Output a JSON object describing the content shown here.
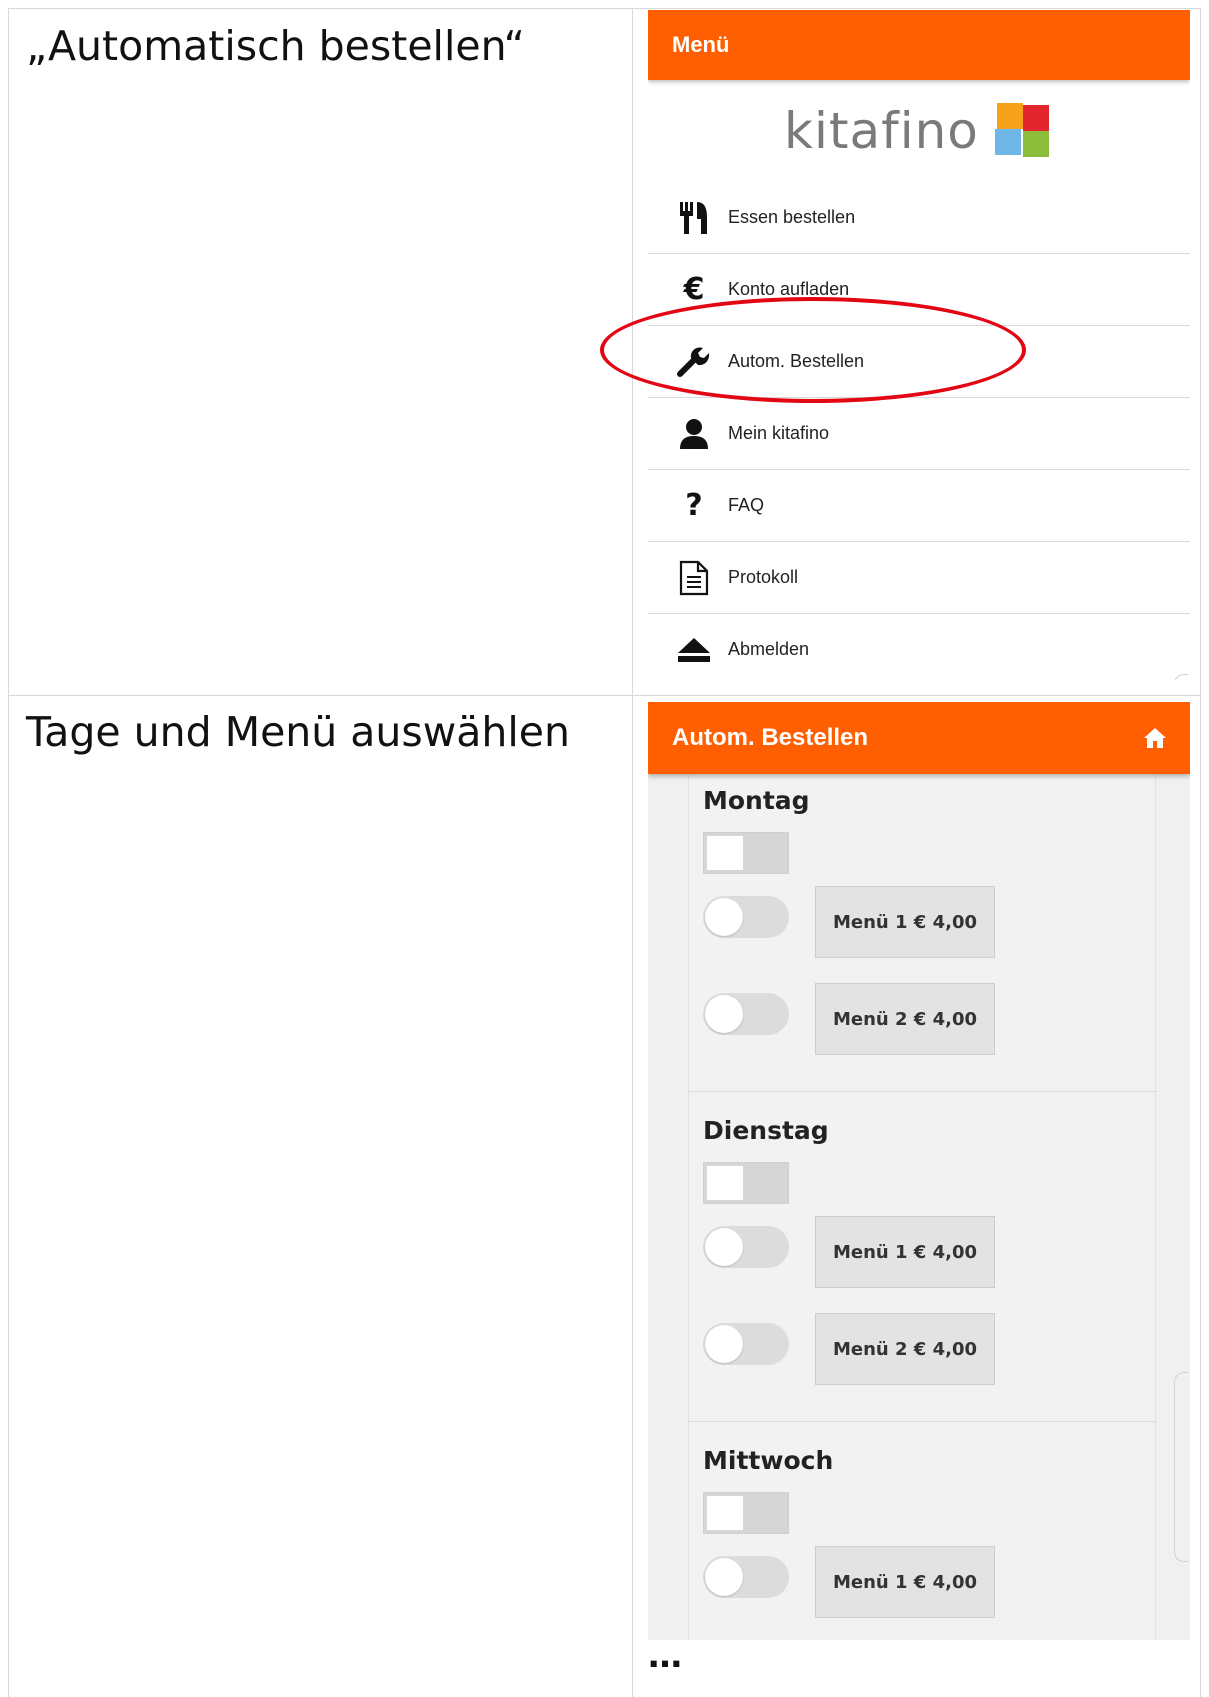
{
  "captions": {
    "first": "„Automatisch bestellen“",
    "second": "Tage und Menü auswählen"
  },
  "menu_screen": {
    "header_title": "Menü",
    "logo_text": "kitafino",
    "items": [
      {
        "label": "Essen bestellen",
        "icon": "cutlery-icon"
      },
      {
        "label": "Konto aufladen",
        "icon": "euro-icon"
      },
      {
        "label": "Autom. Bestellen",
        "icon": "wrench-icon"
      },
      {
        "label": "Mein kitafino",
        "icon": "user-icon"
      },
      {
        "label": "FAQ",
        "icon": "question-icon"
      },
      {
        "label": "Protokoll",
        "icon": "document-icon"
      },
      {
        "label": "Abmelden",
        "icon": "eject-icon"
      }
    ],
    "highlighted_item": "Autom. Bestellen",
    "highlight_color": "#e30613"
  },
  "order_screen": {
    "header_title": "Autom. Bestellen",
    "header_icon": "home-icon",
    "days": [
      {
        "name": "Montag",
        "options": [
          {
            "label": "Menü 1 € 4,00",
            "enabled": false
          },
          {
            "label": "Menü 2 € 4,00",
            "enabled": false
          }
        ]
      },
      {
        "name": "Dienstag",
        "options": [
          {
            "label": "Menü 1 € 4,00",
            "enabled": false
          },
          {
            "label": "Menü 2 € 4,00",
            "enabled": false
          }
        ]
      },
      {
        "name": "Mittwoch",
        "options": [
          {
            "label": "Menü 1 € 4,00",
            "enabled": false
          }
        ]
      }
    ]
  },
  "continuation": "…",
  "colors": {
    "brand_orange": "#ff5f00",
    "highlight_red": "#e30613",
    "panel_gray": "#f2f2f2"
  }
}
